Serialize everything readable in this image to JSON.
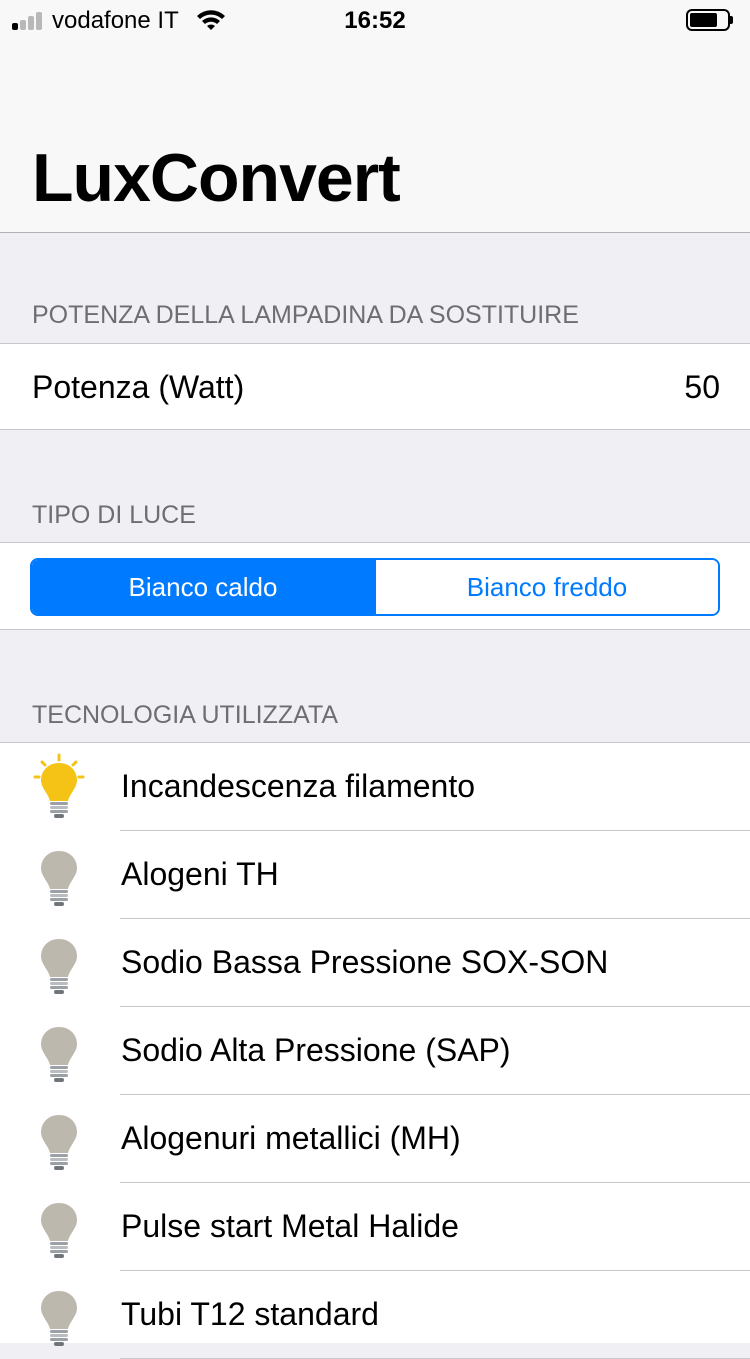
{
  "status_bar": {
    "carrier": "vodafone IT",
    "time": "16:52",
    "signal_bars_filled": 1,
    "signal_bars_total": 4,
    "battery_level": 0.75
  },
  "nav": {
    "title": "LuxConvert"
  },
  "power_section": {
    "header": "POTENZA DELLA LAMPADINA DA SOSTITUIRE",
    "label": "Potenza (Watt)",
    "value": "50"
  },
  "light_section": {
    "header": "TIPO DI LUCE",
    "segments": [
      {
        "label": "Bianco caldo",
        "selected": true
      },
      {
        "label": "Bianco freddo",
        "selected": false
      }
    ]
  },
  "technology_section": {
    "header": "TECNOLOGIA UTILIZZATA",
    "items": [
      {
        "label": "Incandescenza filamento",
        "icon": "lit-lightbulb-icon",
        "active": true
      },
      {
        "label": "Alogeni TH",
        "icon": "lightbulb-icon",
        "active": false
      },
      {
        "label": "Sodio Bassa Pressione SOX-SON",
        "icon": "lightbulb-icon",
        "active": false
      },
      {
        "label": "Sodio Alta Pressione (SAP)",
        "icon": "lightbulb-icon",
        "active": false
      },
      {
        "label": "Alogenuri metallici (MH)",
        "icon": "lightbulb-icon",
        "active": false
      },
      {
        "label": "Pulse start Metal Halide",
        "icon": "lightbulb-icon",
        "active": false
      },
      {
        "label": "Tubi T12 standard",
        "icon": "lightbulb-icon",
        "active": false
      }
    ]
  },
  "colors": {
    "accent": "#007aff",
    "bulb_active": "#f5c315",
    "bulb_inactive": "#bdb8ad",
    "section_header_text": "#6d6d72",
    "grouped_background": "#efeff4"
  }
}
